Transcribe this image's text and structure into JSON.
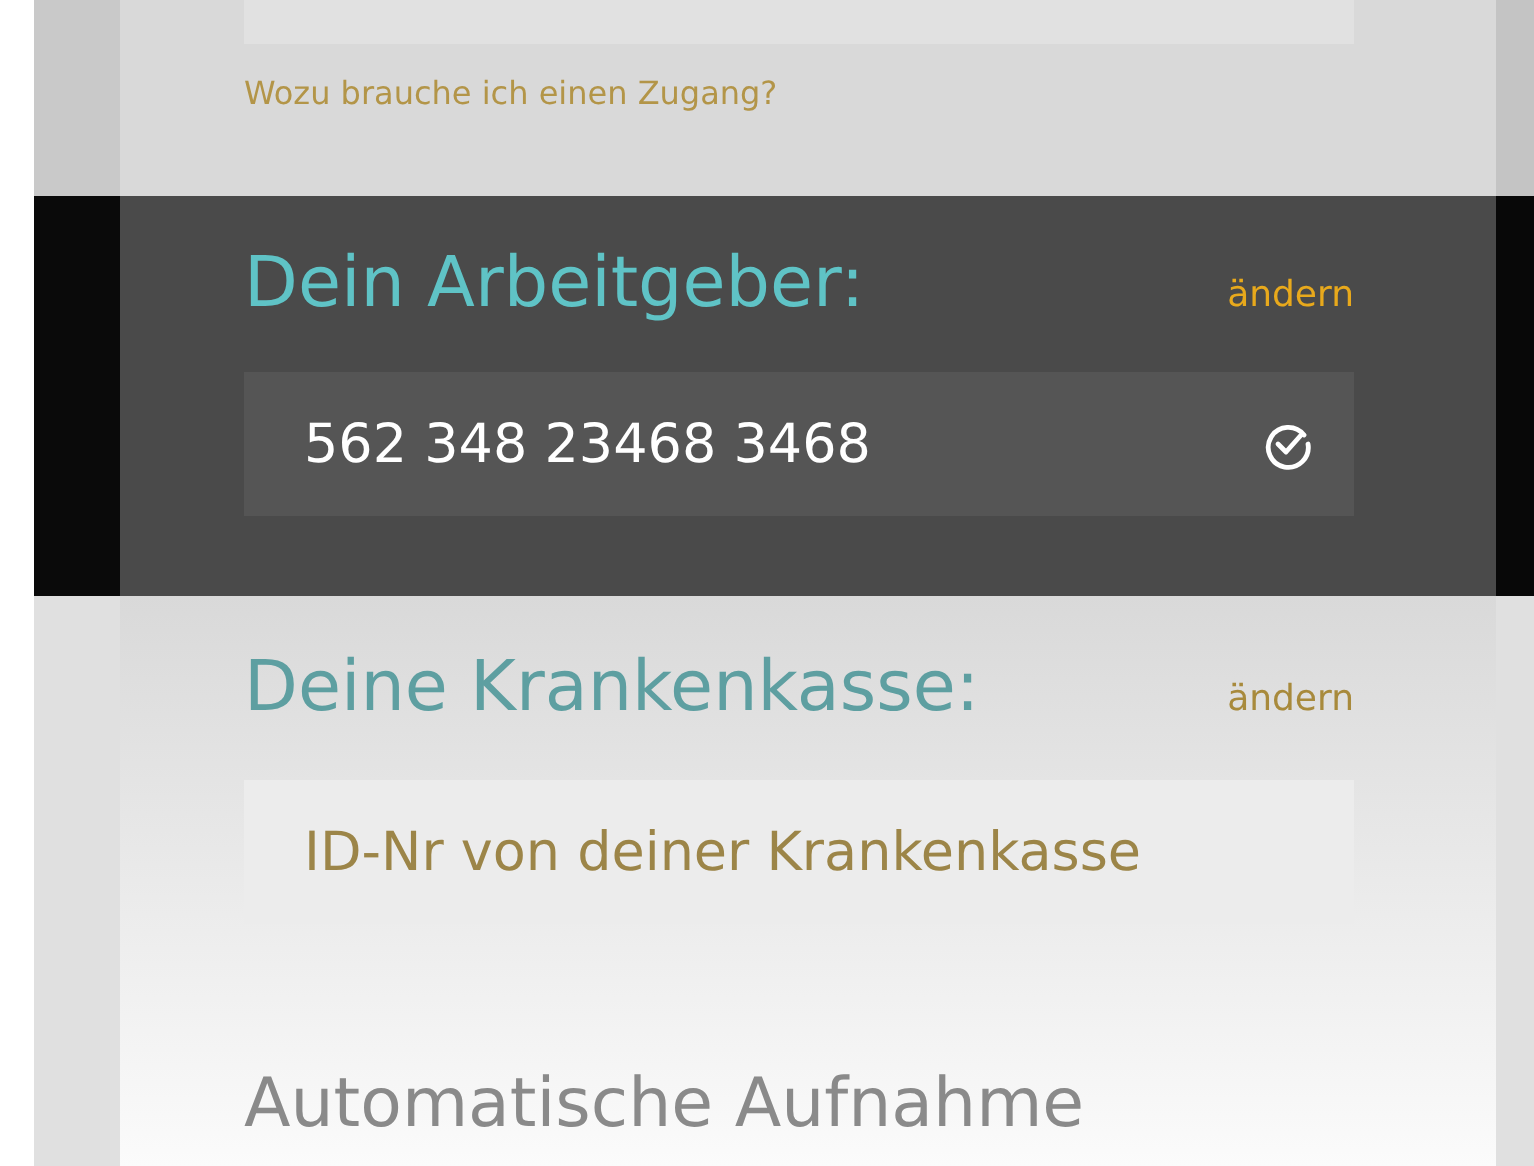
{
  "top_section": {
    "highlighted": false,
    "link": "Wozu brauche ich einen Zugang?"
  },
  "sections": [
    {
      "title": "Dein Arbeitgeber:",
      "change_link": "ändern",
      "highlighted": true,
      "field": {
        "value": "562 348 23468 3468",
        "verified": true
      }
    },
    {
      "title": "Deine Krankenkasse:",
      "change_link": "ändern",
      "highlighted": false,
      "field": {
        "placeholder": "ID-Nr von deiner Krankenkasse",
        "verified": false
      }
    }
  ],
  "next_heading": "Automatische Aufnahme"
}
